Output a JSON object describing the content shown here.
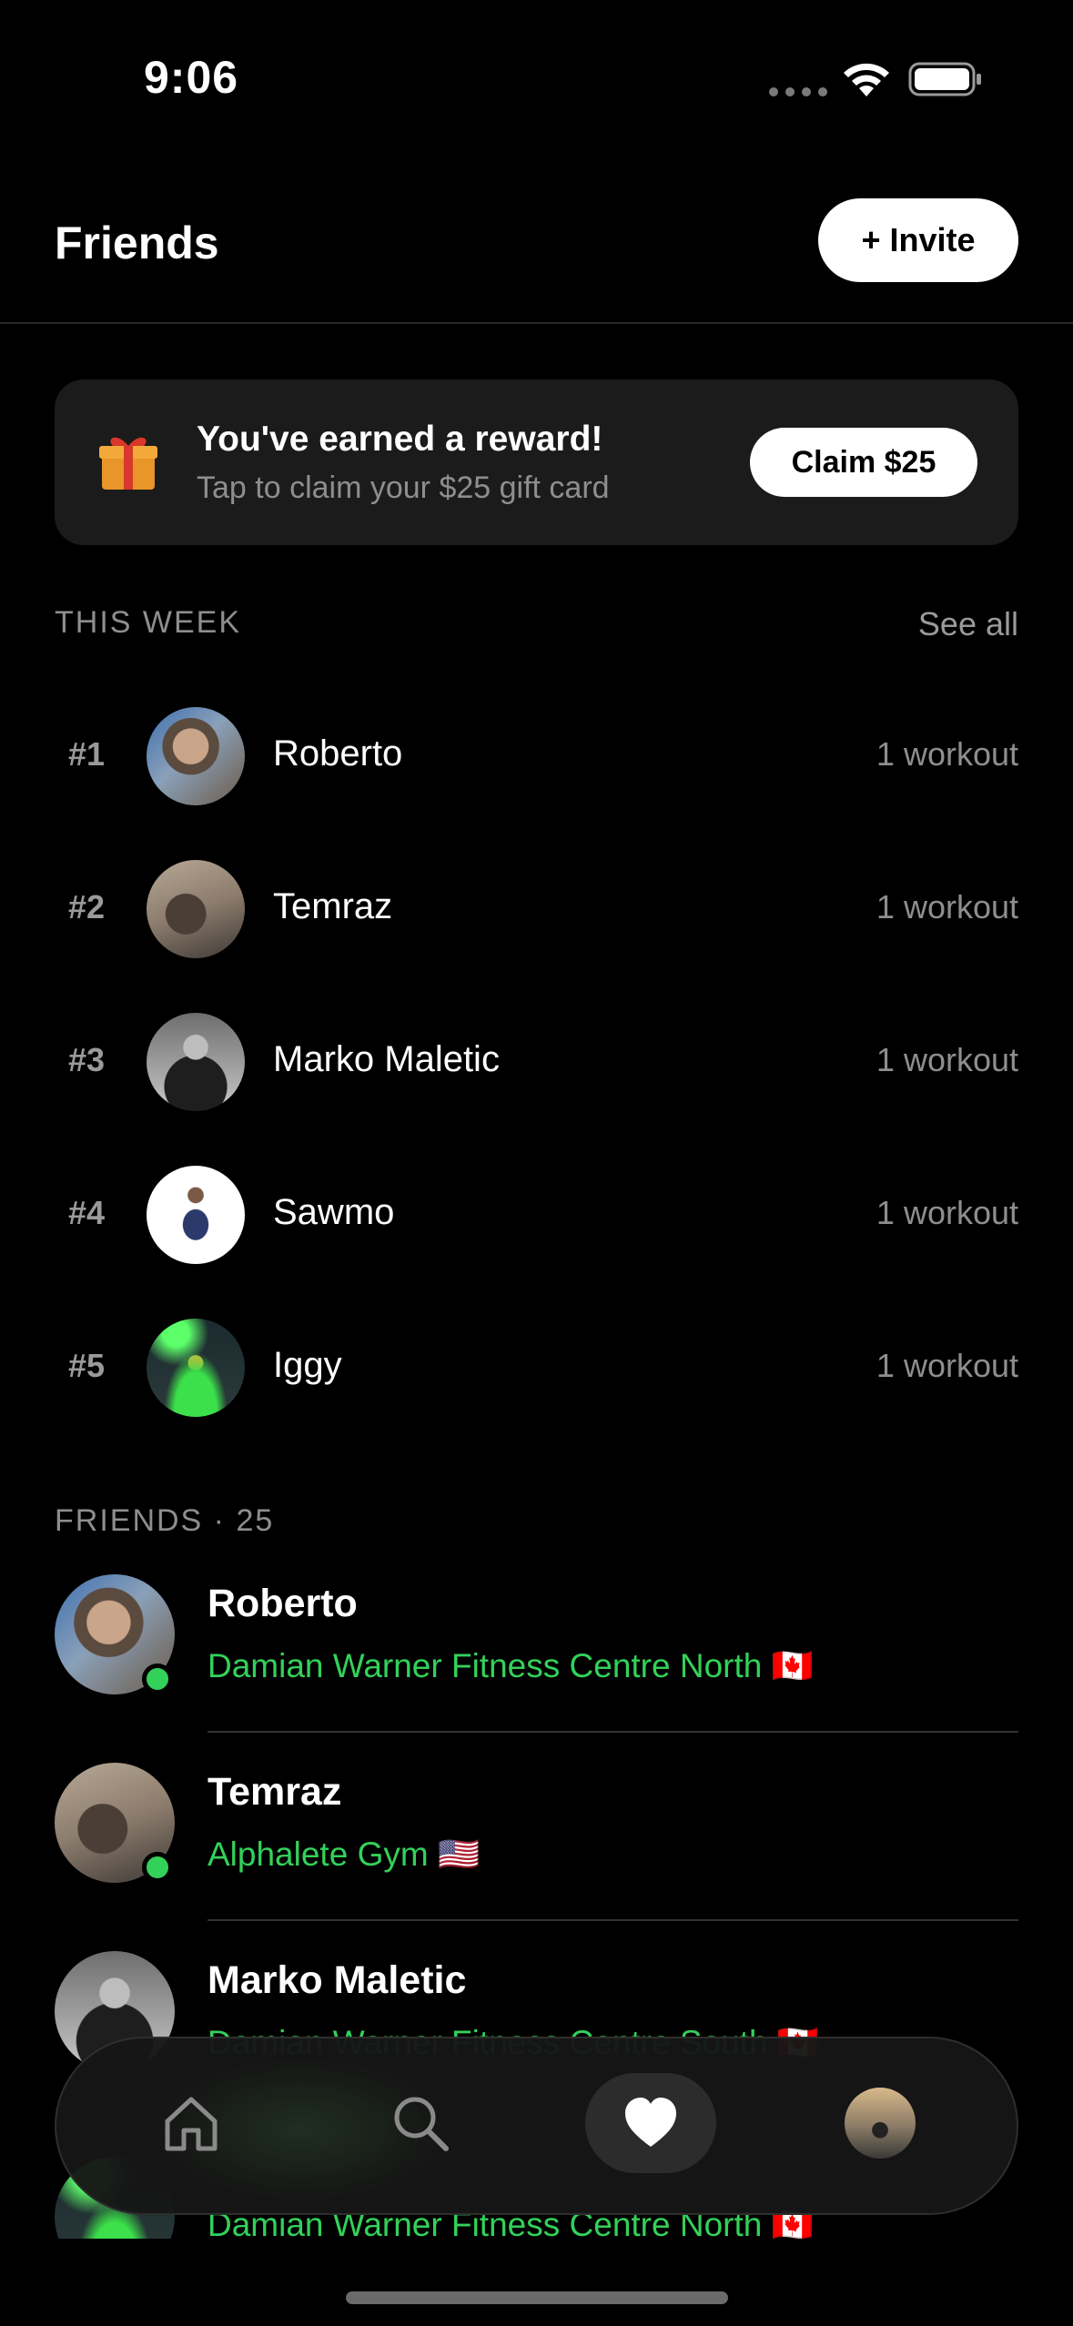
{
  "status_bar": {
    "time": "9:06"
  },
  "header": {
    "title": "Friends",
    "invite_label": "+ Invite"
  },
  "reward": {
    "title": "You've earned a reward!",
    "subtitle": "Tap to claim your $25 gift card",
    "button_label": "Claim $25",
    "icon": "gift-icon"
  },
  "this_week": {
    "label": "THIS WEEK",
    "see_all_label": "See all",
    "leaders": [
      {
        "rank": "#1",
        "name": "Roberto",
        "workouts": "1 workout"
      },
      {
        "rank": "#2",
        "name": "Temraz",
        "workouts": "1 workout"
      },
      {
        "rank": "#3",
        "name": "Marko Maletic",
        "workouts": "1 workout"
      },
      {
        "rank": "#4",
        "name": "Sawmo",
        "workouts": "1 workout"
      },
      {
        "rank": "#5",
        "name": "Iggy",
        "workouts": "1 workout"
      }
    ]
  },
  "friends": {
    "label": "FRIENDS · 25",
    "items": [
      {
        "name": "Roberto",
        "gym": "Damian Warner Fitness Centre North 🇨🇦",
        "online": true
      },
      {
        "name": "Temraz",
        "gym": "Alphalete Gym 🇺🇸",
        "online": true
      },
      {
        "name": "Marko Maletic",
        "gym": "Damian Warner Fitness Centre South 🇨🇦",
        "online": false
      },
      {
        "name": "",
        "gym": "Damian Warner Fitness Centre North 🇨🇦",
        "online": false
      }
    ]
  },
  "tab_bar": {
    "tabs": [
      {
        "name": "home",
        "icon": "home-icon",
        "active": false
      },
      {
        "name": "search",
        "icon": "search-icon",
        "active": false
      },
      {
        "name": "friends",
        "icon": "heart-icon",
        "active": true
      },
      {
        "name": "profile",
        "icon": "avatar",
        "active": false
      }
    ]
  },
  "colors": {
    "background": "#000000",
    "accent_green": "#33d15a",
    "card": "#1b1b1b",
    "muted_text": "#8e8e8e"
  }
}
